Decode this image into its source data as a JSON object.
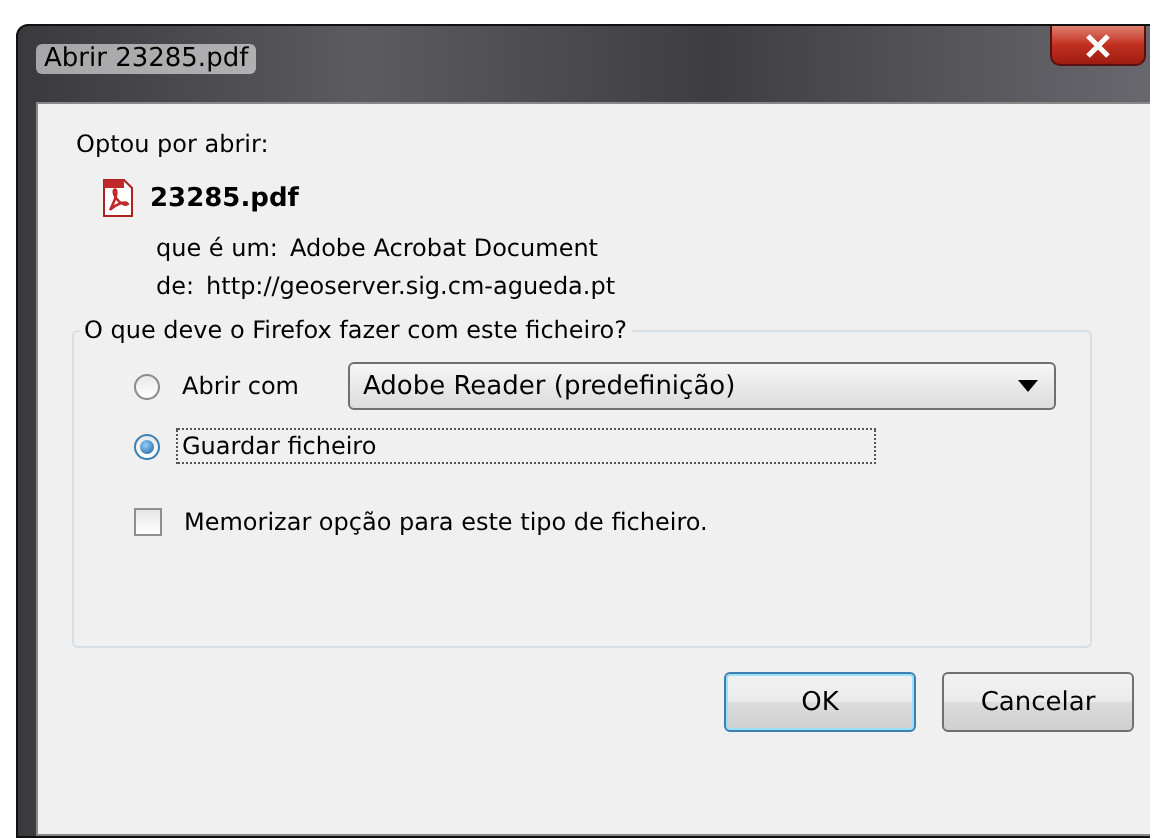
{
  "window": {
    "title": "Abrir 23285.pdf"
  },
  "intro": "Optou por abrir:",
  "file": {
    "name": "23285.pdf",
    "type_label": "que é um:",
    "type": "Adobe Acrobat Document",
    "from_label": "de:",
    "from": "http://geoserver.sig.cm-agueda.pt"
  },
  "group": {
    "legend": "O que deve o Firefox fazer com este ficheiro?",
    "options": [
      {
        "label": "Abrir com",
        "selected": false,
        "app": "Adobe Reader  (predefinição)"
      },
      {
        "label": "Guardar ficheiro",
        "selected": true
      }
    ],
    "remember": {
      "label": "Memorizar opção para este tipo de ficheiro.",
      "checked": false
    }
  },
  "buttons": [
    {
      "label": "OK",
      "default": true
    },
    {
      "label": "Cancelar",
      "default": false
    }
  ]
}
